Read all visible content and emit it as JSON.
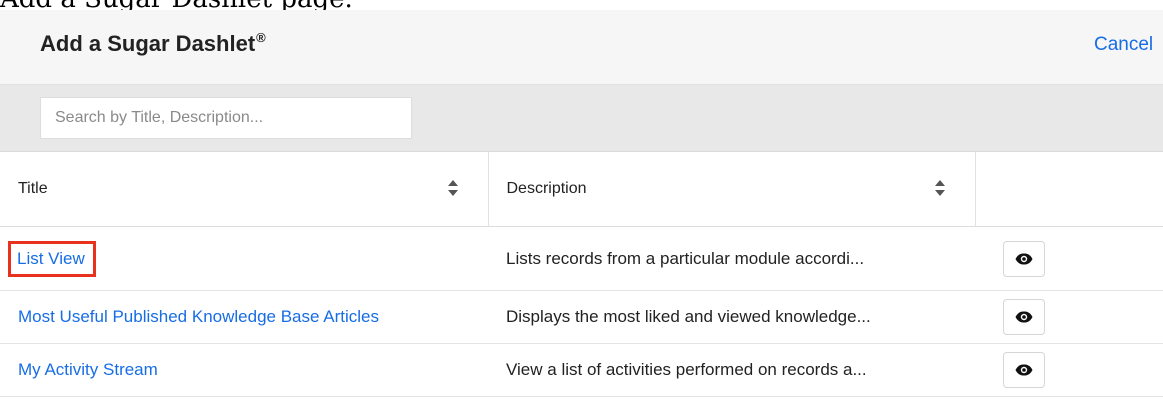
{
  "page_caption": "Add a Sugar Dashlet page.",
  "header": {
    "title": "Add a Sugar Dashlet",
    "title_mark": "®",
    "cancel_label": "Cancel"
  },
  "search": {
    "placeholder": "Search by Title, Description...",
    "value": ""
  },
  "table": {
    "columns": [
      {
        "label": "Title",
        "sortable": true,
        "icon": "sort-icon"
      },
      {
        "label": "Description",
        "sortable": true,
        "icon": "sort-icon"
      },
      {
        "label": "",
        "sortable": false
      }
    ],
    "rows": [
      {
        "title": "List View",
        "description": "Lists records from a particular module accordi...",
        "action_icon": "eye-icon",
        "highlighted": true
      },
      {
        "title": "Most Useful Published Knowledge Base Articles",
        "description": "Displays the most liked and viewed knowledge...",
        "action_icon": "eye-icon",
        "highlighted": false
      },
      {
        "title": "My Activity Stream",
        "description": "View a list of activities performed on records a...",
        "action_icon": "eye-icon",
        "highlighted": false
      }
    ]
  },
  "colors": {
    "link": "#176de5",
    "highlight_border": "#e8321e",
    "header_bg": "#f6f6f6",
    "filter_bg": "#e8e8e8"
  }
}
